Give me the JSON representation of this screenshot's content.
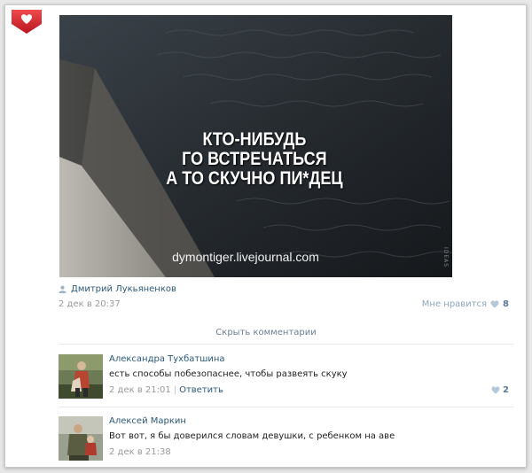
{
  "post": {
    "caption_lines": [
      "КТО-НИБУДЬ",
      "ГО ВСТРЕЧАТЬСЯ",
      "А ТО СКУЧНО ПИ*ДЕЦ"
    ],
    "watermark": "dymontiger.livejournal.com",
    "side_mark": "IDEAS",
    "author": "Дмитрий Лукьяненков",
    "date": "2 дек в 20:37",
    "like_label": "Мне нравится",
    "like_count": "8",
    "hide_comments": "Скрыть комментарии"
  },
  "comments": [
    {
      "name": "Александра Тухбатшина",
      "text": "есть способы побезопаснее, чтобы развеять скуку",
      "date": "2 дек в 21:01",
      "reply": "Ответить",
      "likes": "2"
    },
    {
      "name": "Алексей Маркин",
      "text": "Вот вот, я бы доверился словам девушки, с ребенком на аве",
      "date": "2 дек в 21:38"
    }
  ],
  "colors": {
    "link": "#2b587a",
    "muted": "#999999",
    "badge": "#d8262e"
  },
  "icons": [
    "badge-icon",
    "person-icon",
    "heart-icon"
  ]
}
